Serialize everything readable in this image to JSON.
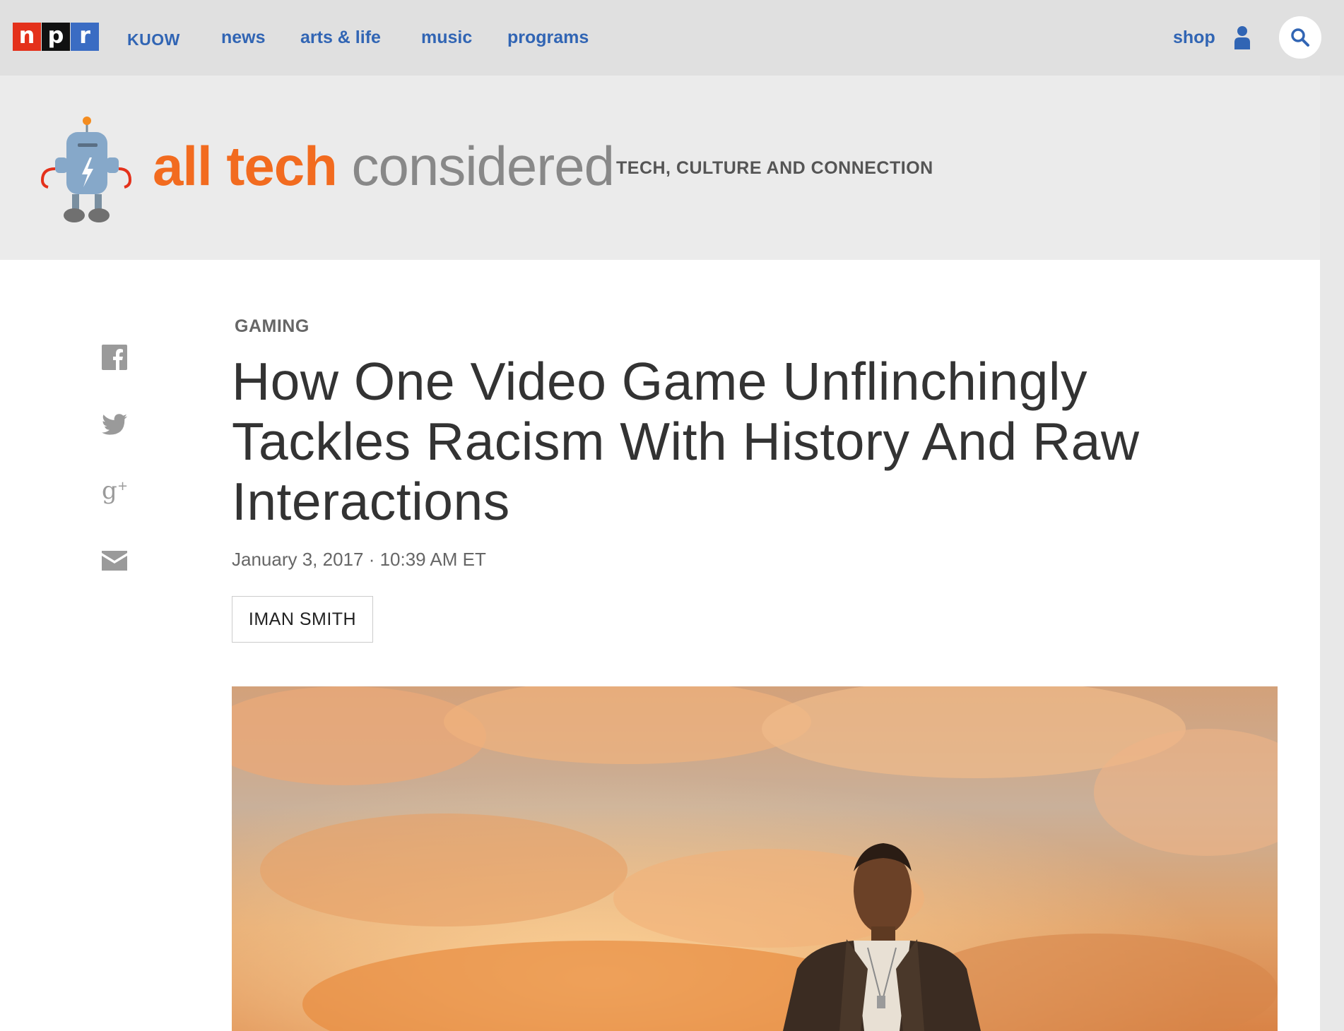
{
  "nav": {
    "logo_letters": [
      "n",
      "p",
      "r"
    ],
    "station": "KUOW",
    "links": [
      "news",
      "arts & life",
      "music",
      "programs"
    ],
    "shop": "shop",
    "icons": [
      "user-icon",
      "search-icon"
    ]
  },
  "banner": {
    "title_part1": "all tech",
    "title_part2": "considered",
    "tagline": "TECH, CULTURE AND CONNECTION",
    "colors": {
      "accent": "#f26b1f",
      "gray_title": "#888888"
    }
  },
  "share": [
    "facebook-icon",
    "twitter-icon",
    "google-plus-icon",
    "email-icon"
  ],
  "article": {
    "slug": "GAMING",
    "headline": "How One Video Game Unflinchingly Tackles Racism With History And Raw Interactions",
    "dateline": "January 3, 2017 · 10:39 AM ET",
    "byline": "IMAN SMITH"
  },
  "colors": {
    "link_blue": "#3165b4",
    "npr_red": "#e4311b",
    "npr_blue": "#3a6cc3"
  }
}
